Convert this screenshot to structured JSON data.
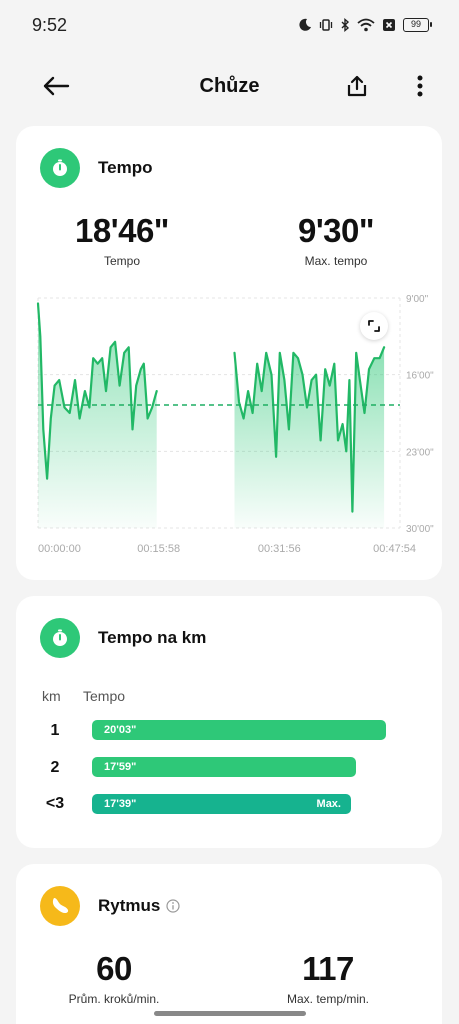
{
  "status_bar": {
    "time": "9:52",
    "battery": "99"
  },
  "app_bar": {
    "title": "Chůze"
  },
  "pace_card": {
    "title": "Tempo",
    "stats": [
      {
        "value": "18'46\"",
        "label": "Tempo"
      },
      {
        "value": "9'30\"",
        "label": "Max. tempo"
      }
    ],
    "chart": {
      "y_ticks": [
        "9'00\"",
        "16'00\"",
        "23'00\"",
        "30'00\""
      ],
      "x_ticks": [
        "00:00:00",
        "00:15:58",
        "00:31:56",
        "00:47:54"
      ]
    }
  },
  "km_card": {
    "title": "Tempo na km",
    "col_km": "km",
    "col_pace": "Tempo",
    "rows": [
      {
        "km": "1",
        "pace": "20'03\"",
        "tag": "",
        "fraction": 1.0,
        "color": "#2ec878"
      },
      {
        "km": "2",
        "pace": "17'59\"",
        "tag": "",
        "fraction": 0.897,
        "color": "#2ec878"
      },
      {
        "km": "<3",
        "pace": "17'39\"",
        "tag": "Max.",
        "fraction": 0.88,
        "color": "#16b38f"
      }
    ]
  },
  "cadence_card": {
    "title": "Rytmus",
    "stats": [
      {
        "value": "60",
        "label": "Prům. kroků/min."
      },
      {
        "value": "117",
        "label": "Max. temp/min."
      }
    ]
  },
  "chart_data": {
    "type": "area",
    "title": "",
    "xlabel": "",
    "ylabel": "",
    "x_unit": "minutes elapsed",
    "y_unit": "pace (min per km)",
    "y_axis_inverted": true,
    "ylim": [
      9,
      30
    ],
    "xlim": [
      0,
      47.9
    ],
    "x_ticks": [
      "00:00:00",
      "00:15:58",
      "00:31:56",
      "00:47:54"
    ],
    "y_ticks": [
      "9'00\"",
      "16'00\"",
      "23'00\"",
      "30'00\""
    ],
    "average_line": 18.77,
    "average_line_style": "dashed",
    "series": [
      {
        "x": [
          0.0,
          0.3,
          0.7,
          1.2,
          1.7,
          2.2,
          2.8,
          3.5,
          4.2,
          4.9,
          5.5,
          6.2,
          6.8,
          7.3,
          7.9,
          8.5,
          9.0,
          9.6,
          10.2,
          10.8,
          11.4,
          12.0,
          12.5,
          13.0,
          13.6,
          14.0,
          14.5,
          15.1,
          15.7
        ],
        "y": [
          9.5,
          12.5,
          21.0,
          25.5,
          20.0,
          17.0,
          16.5,
          19.0,
          19.5,
          16.5,
          20.0,
          17.5,
          19.0,
          14.5,
          15.0,
          14.5,
          17.5,
          13.5,
          13.0,
          17.0,
          14.0,
          13.5,
          21.0,
          17.0,
          15.5,
          15.0,
          20.0,
          19.0,
          17.5
        ]
      },
      {
        "x": [
          26.0,
          26.6,
          27.2,
          27.8,
          28.4,
          29.0,
          29.6,
          30.2,
          30.9,
          31.5,
          32.0,
          32.6,
          33.2,
          33.8,
          34.4,
          35.0,
          35.6,
          36.2,
          36.8,
          37.4,
          38.0,
          38.6,
          39.2,
          39.7,
          40.3,
          40.8,
          41.2,
          41.6,
          42.1,
          42.6,
          43.2,
          43.8,
          44.5,
          45.2,
          45.8
        ],
        "y": [
          14.0,
          18.5,
          20.0,
          17.5,
          19.5,
          15.0,
          17.5,
          14.0,
          16.0,
          23.5,
          14.0,
          16.5,
          21.0,
          14.0,
          14.5,
          16.0,
          19.0,
          16.5,
          16.0,
          22.0,
          15.5,
          17.0,
          15.0,
          22.0,
          20.5,
          23.0,
          16.5,
          28.5,
          14.0,
          16.5,
          19.5,
          15.5,
          14.5,
          14.5,
          13.5
        ]
      }
    ],
    "color": "#22b866",
    "fill": "gradient green",
    "grid": true
  }
}
